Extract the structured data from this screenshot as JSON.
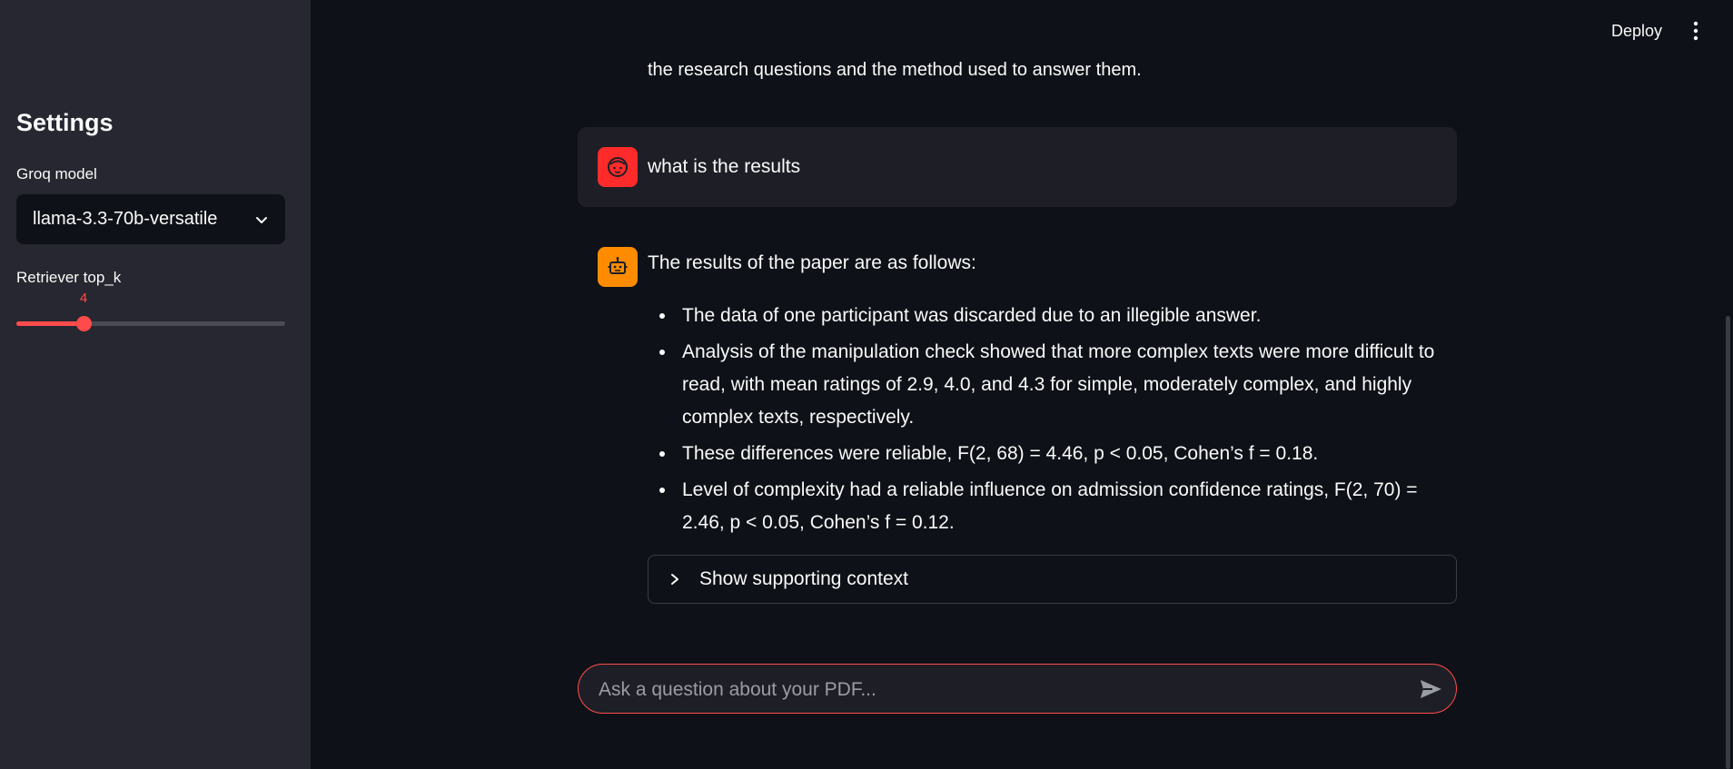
{
  "sidebar": {
    "title": "Settings",
    "model_label": "Groq model",
    "model_value": "llama-3.3-70b-versatile",
    "topk_label": "Retriever top_k",
    "topk_value": "4",
    "topk_fraction": 0.25
  },
  "header": {
    "deploy_label": "Deploy"
  },
  "chat": {
    "previous_text_tail": "the research questions and the method used to answer them.",
    "user_message": "what is the results",
    "assistant_intro": "The results of the paper are as follows:",
    "bullets": [
      "The data of one participant was discarded due to an illegible answer.",
      "Analysis of the manipulation check showed that more complex texts were more difficult to read, with mean ratings of 2.9, 4.0, and 4.3 for simple, moderately complex, and highly complex texts, respectively.",
      "These differences were reliable, F(2, 68) = 4.46, p < 0.05, Cohen’s f = 0.18.",
      "Level of complexity had a reliable influence on admission confidence ratings, F(2, 70) = 2.46, p < 0.05, Cohen’s f = 0.12."
    ],
    "expander_label": "Show supporting context",
    "input_placeholder": "Ask a question about your PDF..."
  },
  "colors": {
    "accent": "#ff4b4b",
    "user_avatar": "#ff2b2b",
    "assistant_avatar": "#ff8c00",
    "sidebar_bg": "#262730",
    "main_bg": "#0e1117"
  }
}
